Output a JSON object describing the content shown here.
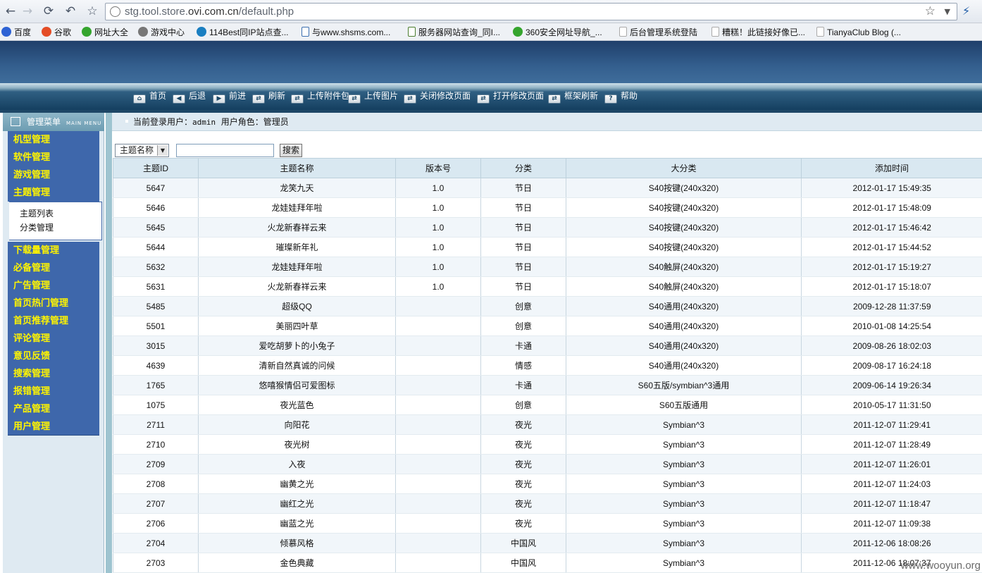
{
  "browser": {
    "url_prefix": "stg.tool.store.",
    "url_host": "ovi.com.cn",
    "url_path": "/default.php",
    "bookmarks": [
      {
        "label": "百度",
        "icon": "baidu-icon",
        "color": "#2e63d4"
      },
      {
        "label": "谷歌",
        "icon": "google-icon",
        "color": "#e44d26"
      },
      {
        "label": "网址大全",
        "icon": "360-icon",
        "color": "#35a52e"
      },
      {
        "label": "游戏中心",
        "icon": "gamepad-icon",
        "color": "#777777"
      },
      {
        "label": "114Best同IP站点查...",
        "icon": "phone-icon",
        "color": "#1a7fc1"
      },
      {
        "label": "与www.shsms.com...",
        "icon": "page-icon",
        "color": "#3b6fb0"
      },
      {
        "label": "服务器网站查询_同I...",
        "icon": "page-icon",
        "color": "#4b7d2e"
      },
      {
        "label": "360安全网址导航_...",
        "icon": "360-icon",
        "color": "#35a52e"
      },
      {
        "label": "后台管理系统登陆",
        "icon": "page-icon",
        "color": "#aaaaaa"
      },
      {
        "label": "糟糕！此链接好像已...",
        "icon": "page-icon",
        "color": "#aaaaaa"
      },
      {
        "label": "TianyaClub Blog (...",
        "icon": "page-icon",
        "color": "#aaaaaa"
      }
    ]
  },
  "toolbar": [
    {
      "label": "首页",
      "icon": "home-icon"
    },
    {
      "label": "后退",
      "icon": "back-icon"
    },
    {
      "label": "前进",
      "icon": "forward-icon"
    },
    {
      "label": "刷新",
      "icon": "refresh-icon"
    },
    {
      "label": "上传附件包",
      "icon": "upload-icon"
    },
    {
      "label": "上传图片",
      "icon": "upload-icon"
    },
    {
      "label": "关闭修改页面",
      "icon": "close-page-icon"
    },
    {
      "label": "打开修改页面",
      "icon": "open-page-icon"
    },
    {
      "label": "框架刷新",
      "icon": "refresh-icon"
    },
    {
      "label": "帮助",
      "icon": "help-icon"
    }
  ],
  "sidebar": {
    "title": "管理菜单",
    "subtitle": "MAIN MENU",
    "menu": [
      "机型管理",
      "软件管理",
      "游戏管理",
      "主题管理",
      "下载量管理",
      "必备管理",
      "广告管理",
      "首页热门管理",
      "首页推荐管理",
      "评论管理",
      "意见反馈",
      "搜索管理",
      "报错管理",
      "产品管理",
      "用户管理"
    ],
    "submenu": [
      "主题列表",
      "分类管理"
    ]
  },
  "info": {
    "login_label": "当前登录用户：",
    "login_user": "admin",
    "role_label": "用户角色：",
    "role": "管理员"
  },
  "search": {
    "select_value": "主题名称",
    "input_value": "",
    "button": "搜索"
  },
  "table": {
    "headers": [
      "主题ID",
      "主题名称",
      "版本号",
      "分类",
      "大分类",
      "添加时间"
    ],
    "rows": [
      [
        "5647",
        "龙笑九天",
        "1.0",
        "节日",
        "S40按键(240x320)",
        "2012-01-17 15:49:35"
      ],
      [
        "5646",
        "龙娃娃拜年啦",
        "1.0",
        "节日",
        "S40按键(240x320)",
        "2012-01-17 15:48:09"
      ],
      [
        "5645",
        "火龙新春祥云来",
        "1.0",
        "节日",
        "S40按键(240x320)",
        "2012-01-17 15:46:42"
      ],
      [
        "5644",
        "璀璨新年礼",
        "1.0",
        "节日",
        "S40按键(240x320)",
        "2012-01-17 15:44:52"
      ],
      [
        "5632",
        "龙娃娃拜年啦",
        "1.0",
        "节日",
        "S40触屏(240x320)",
        "2012-01-17 15:19:27"
      ],
      [
        "5631",
        "火龙新春祥云来",
        "1.0",
        "节日",
        "S40触屏(240x320)",
        "2012-01-17 15:18:07"
      ],
      [
        "5485",
        "超级QQ",
        "",
        "创意",
        "S40通用(240x320)",
        "2009-12-28 11:37:59"
      ],
      [
        "5501",
        "美丽四叶草",
        "",
        "创意",
        "S40通用(240x320)",
        "2010-01-08 14:25:54"
      ],
      [
        "3015",
        "爱吃胡萝卜的小兔子",
        "",
        "卡通",
        "S40通用(240x320)",
        "2009-08-26 18:02:03"
      ],
      [
        "4639",
        "清新自然真诚的问候",
        "",
        "情感",
        "S40通用(240x320)",
        "2009-08-17 16:24:18"
      ],
      [
        "1765",
        "悠嘻猴情侣可爱图标",
        "",
        "卡通",
        "S60五版/symbian^3通用",
        "2009-06-14 19:26:34"
      ],
      [
        "1075",
        "夜光蓝色",
        "",
        "创意",
        "S60五版通用",
        "2010-05-17 11:31:50"
      ],
      [
        "2711",
        "向阳花",
        "",
        "夜光",
        "Symbian^3",
        "2011-12-07 11:29:41"
      ],
      [
        "2710",
        "夜光树",
        "",
        "夜光",
        "Symbian^3",
        "2011-12-07 11:28:49"
      ],
      [
        "2709",
        "入夜",
        "",
        "夜光",
        "Symbian^3",
        "2011-12-07 11:26:01"
      ],
      [
        "2708",
        "幽黄之光",
        "",
        "夜光",
        "Symbian^3",
        "2011-12-07 11:24:03"
      ],
      [
        "2707",
        "幽红之光",
        "",
        "夜光",
        "Symbian^3",
        "2011-12-07 11:18:47"
      ],
      [
        "2706",
        "幽蓝之光",
        "",
        "夜光",
        "Symbian^3",
        "2011-12-07 11:09:38"
      ],
      [
        "2704",
        "倾慕风格",
        "",
        "中国风",
        "Symbian^3",
        "2011-12-06 18:08:26"
      ],
      [
        "2703",
        "金色典藏",
        "",
        "中国风",
        "Symbian^3",
        "2011-12-06 18:07:37"
      ]
    ]
  },
  "watermark": "www.wooyun.org"
}
